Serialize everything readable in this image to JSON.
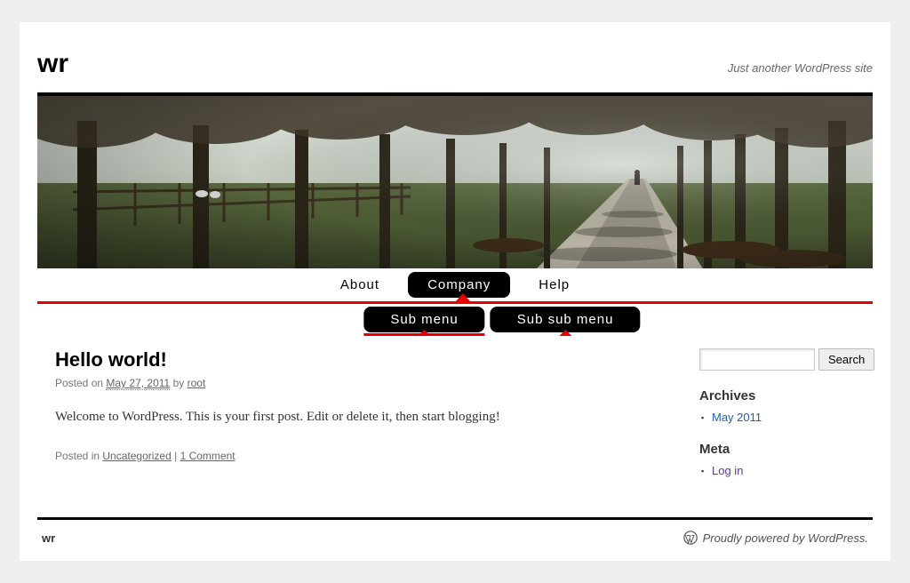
{
  "site": {
    "title": "wr",
    "tagline": "Just another WordPress site"
  },
  "nav": {
    "items": [
      {
        "label": "About",
        "active": false
      },
      {
        "label": "Company",
        "active": true
      },
      {
        "label": "Help",
        "active": false
      }
    ],
    "sub": [
      {
        "label": "Sub menu",
        "underline": true
      },
      {
        "label": "Sub sub menu",
        "underline": false
      }
    ]
  },
  "post": {
    "title": "Hello world!",
    "posted_on_label": "Posted on",
    "date": "May 27, 2011",
    "by_label": "by",
    "author": "root",
    "body": "Welcome to WordPress. This is your first post. Edit or delete it, then start blogging!",
    "posted_in_label": "Posted in",
    "category": "Uncategorized",
    "comments_label": "1 Comment"
  },
  "search": {
    "button": "Search"
  },
  "widgets": {
    "archives": {
      "title": "Archives",
      "items": [
        "May 2011"
      ]
    },
    "meta": {
      "title": "Meta",
      "items": [
        "Log in"
      ]
    }
  },
  "footer": {
    "left": "wr",
    "right": "Proudly powered by WordPress."
  }
}
